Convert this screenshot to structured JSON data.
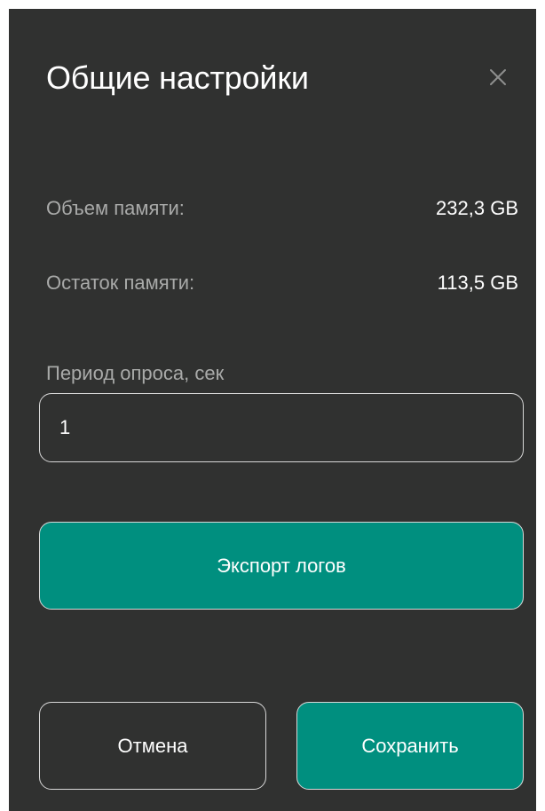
{
  "dialog": {
    "title": "Общие настройки",
    "close_icon": "close-icon"
  },
  "memory": {
    "total_label": "Объем памяти:",
    "total_value": "232,3 GB",
    "free_label": "Остаток памяти:",
    "free_value": "113,5 GB"
  },
  "poll_period": {
    "label": "Период опроса, сек",
    "value": "1"
  },
  "actions": {
    "export_label": "Экспорт логов",
    "cancel_label": "Отмена",
    "save_label": "Сохранить"
  },
  "colors": {
    "panel_bg": "#303130",
    "accent": "#008f7f",
    "muted_text": "#a9aaa9",
    "text": "#ffffff"
  }
}
